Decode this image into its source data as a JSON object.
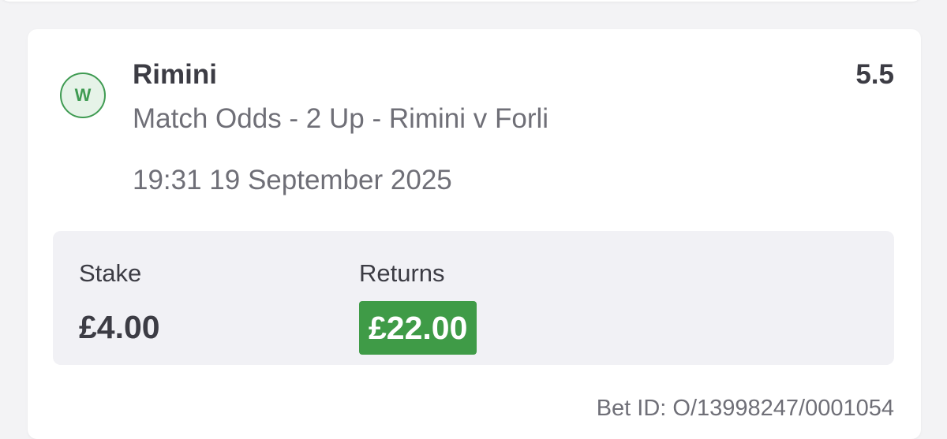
{
  "bet": {
    "result_badge": "W",
    "selection": "Rimini",
    "odds": "5.5",
    "market": "Match Odds - 2 Up - Rimini v Forli",
    "datetime": "19:31 19 September 2025",
    "stake_label": "Stake",
    "stake_value": "£4.00",
    "returns_label": "Returns",
    "returns_value": "£22.00",
    "bet_id": "Bet ID: O/13998247/0001054",
    "status": "won"
  },
  "colors": {
    "win_green": "#3f9b47",
    "badge_background": "#e6f3e8",
    "primary_text": "#3c3c44",
    "secondary_text": "#6f6f77",
    "page_background": "#f3f3f5",
    "amount_panel": "#f1f1f5"
  }
}
